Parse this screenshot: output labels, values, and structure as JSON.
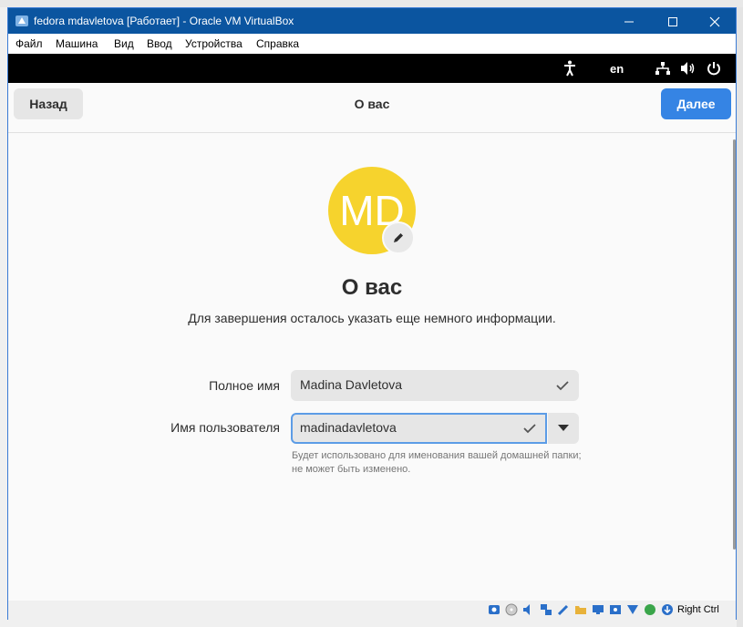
{
  "window": {
    "title": "fedora mdavletova [Работает] - Oracle VM VirtualBox",
    "minimize_icon": "minimize-icon",
    "maximize_icon": "maximize-icon",
    "close_icon": "close-icon"
  },
  "menu": [
    "Файл",
    "Машина",
    "Вид",
    "Ввод",
    "Устройства",
    "Справка"
  ],
  "gnome_bar": {
    "language": "en",
    "icons": [
      "accessibility-icon",
      "network-icon",
      "volume-icon",
      "power-icon"
    ]
  },
  "header": {
    "back_label": "Назад",
    "title": "О вас",
    "next_label": "Далее"
  },
  "colors": {
    "accent": "#3584e4",
    "avatar": "#f6d32d",
    "titlebar": "#0b55a0"
  },
  "avatar": {
    "initials": "MD",
    "edit_icon": "pencil-icon"
  },
  "page": {
    "heading": "О вас",
    "subtitle": "Для завершения осталось указать еще немного информации."
  },
  "form": {
    "full_name_label": "Полное имя",
    "full_name_value": "Madina Davletova",
    "username_label": "Имя пользователя",
    "username_value": "madinadavletova",
    "username_hint": "Будет использовано для именования вашей домашней папки; не может быть изменено."
  },
  "statusbar": {
    "host_key": "Right Ctrl"
  }
}
